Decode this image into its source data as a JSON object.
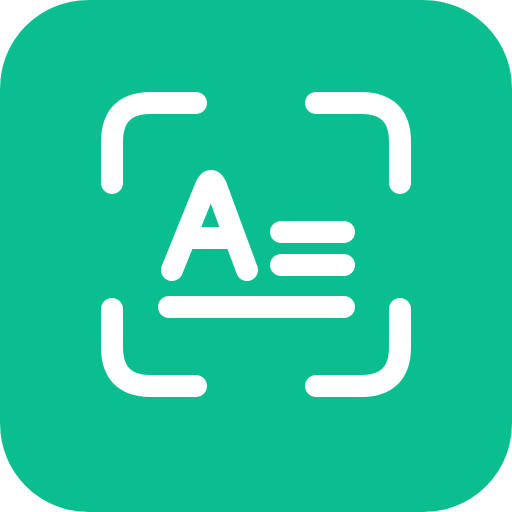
{
  "icon": {
    "name": "text-scanner-app-icon",
    "glyph": "letter-a-icon",
    "frame": "scan-frame-icon",
    "background_color": "#0BBE8F",
    "foreground_color": "#FFFFFF"
  }
}
